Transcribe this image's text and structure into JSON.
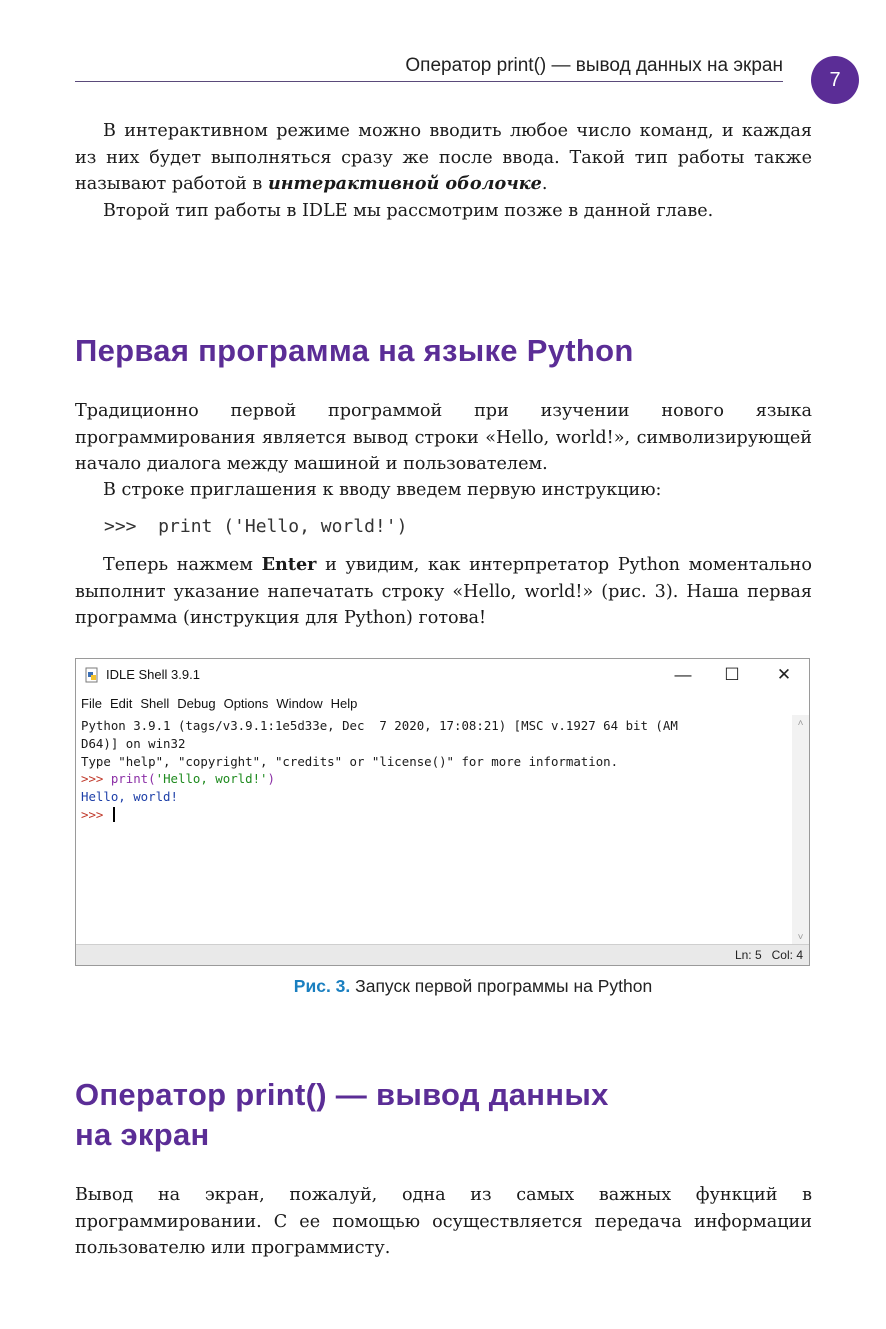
{
  "header": {
    "running_title": "Оператор print() — вывод данных на экран",
    "page_number": "7"
  },
  "intro": {
    "p1_text": "В интерактивном режиме можно вводить любое число команд, и каждая из них будет выполняться сразу же после ввода. Такой тип работы также называют работой в ",
    "p1_emphasis": "интерактивной оболочке",
    "p1_end": ".",
    "p2": "Второй тип работы в IDLE мы рассмотрим позже в данной главе."
  },
  "section1": {
    "heading": "Первая программа на языке Python",
    "p1": "Традиционно первой программой при изучении нового языка программирования является вывод строки «Hello, world!», символизирующей начало диалога между машиной и пользователем.",
    "p2": "В строке приглашения к вводу введем первую инструкцию:",
    "code": ">>>  print ('Hello, world!')",
    "p3_start": "Теперь нажмем ",
    "p3_bold": "Enter",
    "p3_end": " и увидим, как интерпретатор Python моментально выполнит указание напечатать строку «Hello, world!» (рис. 3). Наша первая программа (инструкция для Python) готова!"
  },
  "idle_window": {
    "title": "IDLE Shell 3.9.1",
    "minimize": "—",
    "maximize": "☐",
    "close": "✕",
    "menu": [
      "File",
      "Edit",
      "Shell",
      "Debug",
      "Options",
      "Window",
      "Help"
    ],
    "lines": {
      "l1": "Python 3.9.1 (tags/v3.9.1:1e5d33e, Dec  7 2020, 17:08:21) [MSC v.1927 64 bit (AM",
      "l2": "D64)] on win32",
      "l3": "Type \"help\", \"copyright\", \"credits\" or \"license()\" for more information.",
      "prompt": ">>> ",
      "cmd_fn": "print(",
      "cmd_str": "'Hello, world!'",
      "cmd_close": ")",
      "output": "Hello, world!"
    },
    "status": "Ln: 5   Col: 4"
  },
  "figure": {
    "label": "Рис. 3.",
    "caption": " Запуск первой программы на Python"
  },
  "section2": {
    "heading_line1": "Оператор print() — вывод данных",
    "heading_line2": "на экран",
    "p1": "Вывод на экран, пожалуй, одна из самых важных функций в программировании. С ее помощью осуществляется передача информации пользователю или программисту."
  }
}
